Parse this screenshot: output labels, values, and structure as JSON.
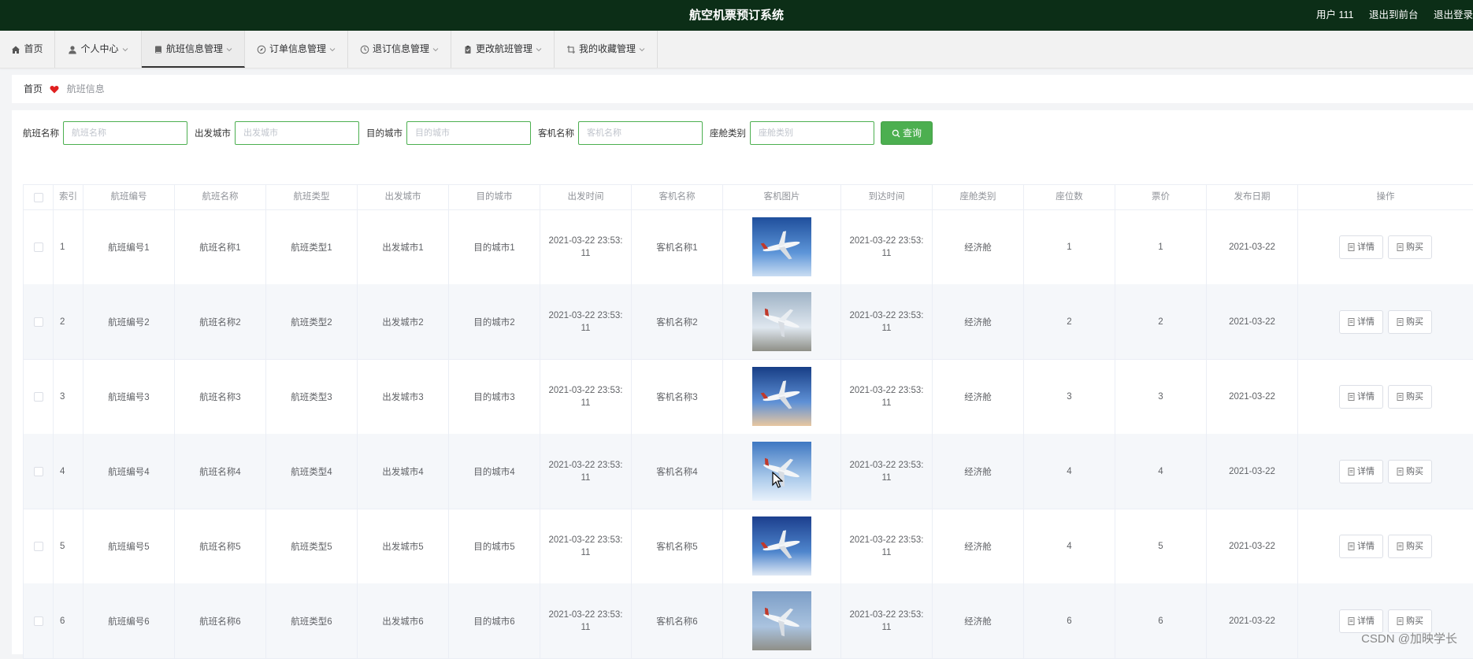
{
  "header": {
    "title": "航空机票预订系统",
    "user_label": "用户 111",
    "back_front": "退出到前台",
    "logout": "退出登录"
  },
  "nav": [
    {
      "label": "首页",
      "icon": "home-icon",
      "dropdown": false
    },
    {
      "label": "个人中心",
      "icon": "user-icon",
      "dropdown": true
    },
    {
      "label": "航班信息管理",
      "icon": "book-icon",
      "dropdown": true,
      "active": true
    },
    {
      "label": "订单信息管理",
      "icon": "compass-icon",
      "dropdown": true
    },
    {
      "label": "退订信息管理",
      "icon": "clock-icon",
      "dropdown": true
    },
    {
      "label": "更改航班管理",
      "icon": "clipboard-icon",
      "dropdown": true
    },
    {
      "label": "我的收藏管理",
      "icon": "crop-icon",
      "dropdown": true
    }
  ],
  "breadcrumb": {
    "home": "首页",
    "current": "航班信息"
  },
  "search": {
    "fields": [
      {
        "label": "航班名称",
        "placeholder": "航班名称"
      },
      {
        "label": "出发城市",
        "placeholder": "出发城市"
      },
      {
        "label": "目的城市",
        "placeholder": "目的城市"
      },
      {
        "label": "客机名称",
        "placeholder": "客机名称"
      },
      {
        "label": "座舱类别",
        "placeholder": "座舱类别"
      }
    ],
    "button": "查询"
  },
  "table": {
    "headers": [
      "",
      "索引",
      "航班编号",
      "航班名称",
      "航班类型",
      "出发城市",
      "目的城市",
      "出发时间",
      "客机名称",
      "客机图片",
      "到达时间",
      "座舱类别",
      "座位数",
      "票价",
      "发布日期",
      "操作"
    ],
    "actions": {
      "detail": "详情",
      "buy": "购买"
    },
    "rows": [
      {
        "index": "1",
        "flight_no": "航班编号1",
        "flight_name": "航班名称1",
        "flight_type": "航班类型1",
        "from": "出发城市1",
        "to": "目的城市1",
        "depart": "2021-03-22 23:53:11",
        "plane": "客机名称1",
        "arrive": "2021-03-22 23:53:11",
        "cabin": "经济舱",
        "seats": "1",
        "price": "1",
        "date": "2021-03-22"
      },
      {
        "index": "2",
        "flight_no": "航班编号2",
        "flight_name": "航班名称2",
        "flight_type": "航班类型2",
        "from": "出发城市2",
        "to": "目的城市2",
        "depart": "2021-03-22 23:53:11",
        "plane": "客机名称2",
        "arrive": "2021-03-22 23:53:11",
        "cabin": "经济舱",
        "seats": "2",
        "price": "2",
        "date": "2021-03-22"
      },
      {
        "index": "3",
        "flight_no": "航班编号3",
        "flight_name": "航班名称3",
        "flight_type": "航班类型3",
        "from": "出发城市3",
        "to": "目的城市3",
        "depart": "2021-03-22 23:53:11",
        "plane": "客机名称3",
        "arrive": "2021-03-22 23:53:11",
        "cabin": "经济舱",
        "seats": "3",
        "price": "3",
        "date": "2021-03-22"
      },
      {
        "index": "4",
        "flight_no": "航班编号4",
        "flight_name": "航班名称4",
        "flight_type": "航班类型4",
        "from": "出发城市4",
        "to": "目的城市4",
        "depart": "2021-03-22 23:53:11",
        "plane": "客机名称4",
        "arrive": "2021-03-22 23:53:11",
        "cabin": "经济舱",
        "seats": "4",
        "price": "4",
        "date": "2021-03-22"
      },
      {
        "index": "5",
        "flight_no": "航班编号5",
        "flight_name": "航班名称5",
        "flight_type": "航班类型5",
        "from": "出发城市5",
        "to": "目的城市5",
        "depart": "2021-03-22 23:53:11",
        "plane": "客机名称5",
        "arrive": "2021-03-22 23:53:11",
        "cabin": "经济舱",
        "seats": "4",
        "price": "5",
        "date": "2021-03-22"
      },
      {
        "index": "6",
        "flight_no": "航班编号6",
        "flight_name": "航班名称6",
        "flight_type": "航班类型6",
        "from": "出发城市6",
        "to": "目的城市6",
        "depart": "2021-03-22 23:53:11",
        "plane": "客机名称6",
        "arrive": "2021-03-22 23:53:11",
        "cabin": "经济舱",
        "seats": "6",
        "price": "6",
        "date": "2021-03-22"
      }
    ]
  },
  "watermark": "CSDN @加映学长",
  "colors": {
    "topbar": "#0c2e17",
    "accent": "#4caf50",
    "heart": "#e02020"
  }
}
